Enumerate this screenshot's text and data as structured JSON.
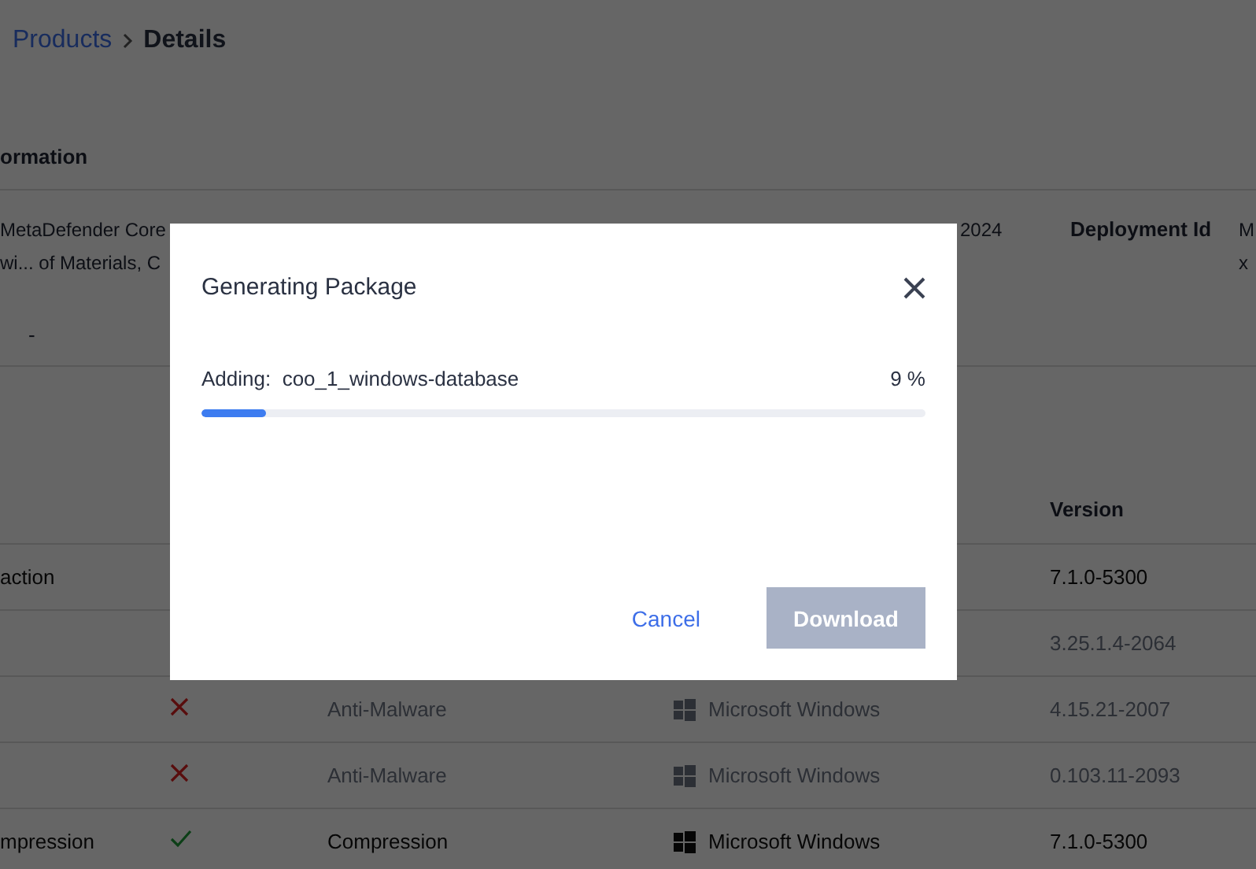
{
  "breadcrumb": {
    "link": "Products",
    "current": "Details"
  },
  "section_title": "ormation",
  "info": {
    "name_lines": [
      "MetaDefender Core",
      "wi... of Materials, C"
    ],
    "dash": "-",
    "date": "2024",
    "deployment_label": "Deployment Id",
    "deployment_value": [
      "M",
      "x"
    ]
  },
  "table": {
    "version_header": "Version",
    "rows": [
      {
        "name": "action",
        "version": "7.1.0-5300",
        "disabled": false
      },
      {
        "version": "3.25.1.4-2064",
        "disabled": true
      },
      {
        "supported": false,
        "type": "Anti-Malware",
        "platform": "Microsoft Windows",
        "version": "4.15.21-2007",
        "disabled": true
      },
      {
        "supported": false,
        "type": "Anti-Malware",
        "platform": "Microsoft Windows",
        "version": "0.103.11-2093",
        "disabled": true
      },
      {
        "name": "mpression",
        "supported": true,
        "type": "Compression",
        "platform": "Microsoft Windows",
        "version": "7.1.0-5300",
        "disabled": false
      }
    ]
  },
  "dialog": {
    "title": "Generating Package",
    "progress_label": "Adding:  coo_1_windows-database",
    "percent": "9 %",
    "level": 0.09,
    "buttons": [
      {
        "kind": "link",
        "label": "Cancel",
        "disabled": false
      },
      {
        "kind": "primary",
        "label": "Download",
        "disabled": true
      }
    ]
  }
}
